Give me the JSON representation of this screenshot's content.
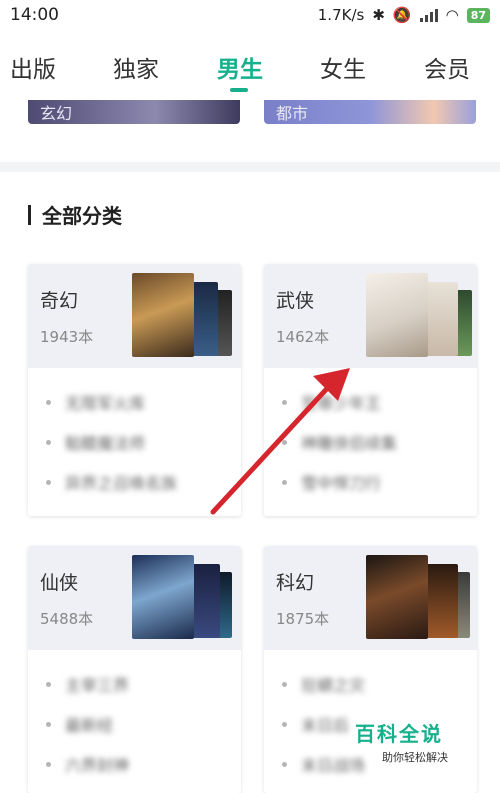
{
  "status_bar": {
    "time": "14:00",
    "network_speed": "1.7K/s",
    "battery": "87"
  },
  "tabs": [
    {
      "label": "出版",
      "active": false
    },
    {
      "label": "独家",
      "active": false
    },
    {
      "label": "男生",
      "active": true
    },
    {
      "label": "女生",
      "active": false
    },
    {
      "label": "会员",
      "active": false
    }
  ],
  "banners": [
    {
      "label": "玄幻"
    },
    {
      "label": "都市"
    }
  ],
  "section": {
    "title": "全部分类"
  },
  "categories": [
    {
      "name": "奇幻",
      "count": "1943本",
      "subs": [
        "无限军火库",
        "骷髅魔法师",
        "异界之召唤名族"
      ]
    },
    {
      "name": "武侠",
      "count": "1462本",
      "subs": [
        "至尊少年王",
        "神雕侠侣续集",
        "雪中悍刀行"
      ]
    },
    {
      "name": "仙侠",
      "count": "5488本",
      "subs": [
        "主宰三界",
        "最新经",
        "六界封神"
      ]
    },
    {
      "name": "科幻",
      "count": "1875本",
      "subs": [
        "狂蟒之灾",
        "末日后",
        "末日战场"
      ]
    }
  ],
  "watermark": {
    "title": "百科全说",
    "subtitle": "助你轻松解决"
  },
  "colors": {
    "accent": "#17b08c",
    "arrow": "#d6262d"
  }
}
